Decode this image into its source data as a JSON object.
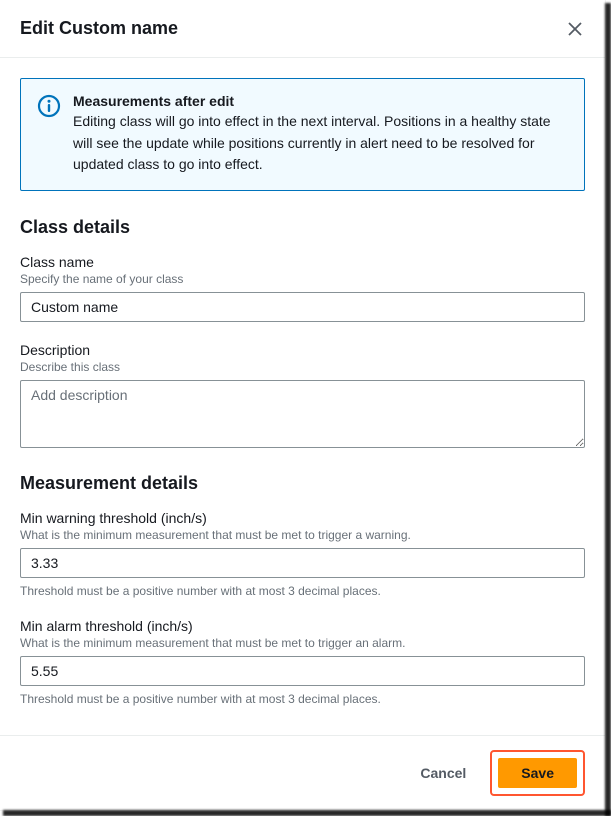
{
  "modal": {
    "title": "Edit Custom name",
    "info": {
      "title": "Measurements after edit",
      "description": "Editing class will go into effect in the next interval. Positions in a healthy state will see the update while positions currently in alert need to be resolved for updated class to go into effect."
    }
  },
  "classDetails": {
    "sectionTitle": "Class details",
    "name": {
      "label": "Class name",
      "hint": "Specify the name of your class",
      "value": "Custom name"
    },
    "description": {
      "label": "Description",
      "hint": "Describe this class",
      "placeholder": "Add description",
      "value": ""
    }
  },
  "measurementDetails": {
    "sectionTitle": "Measurement details",
    "minWarning": {
      "label": "Min warning threshold (inch/s)",
      "hint": "What is the minimum measurement that must be met to trigger a warning.",
      "value": "3.33",
      "constraint": "Threshold must be a positive number with at most 3 decimal places."
    },
    "minAlarm": {
      "label": "Min alarm threshold (inch/s)",
      "hint": "What is the minimum measurement that must be met to trigger an alarm.",
      "value": "5.55",
      "constraint": "Threshold must be a positive number with at most 3 decimal places."
    }
  },
  "footer": {
    "cancel": "Cancel",
    "save": "Save"
  }
}
